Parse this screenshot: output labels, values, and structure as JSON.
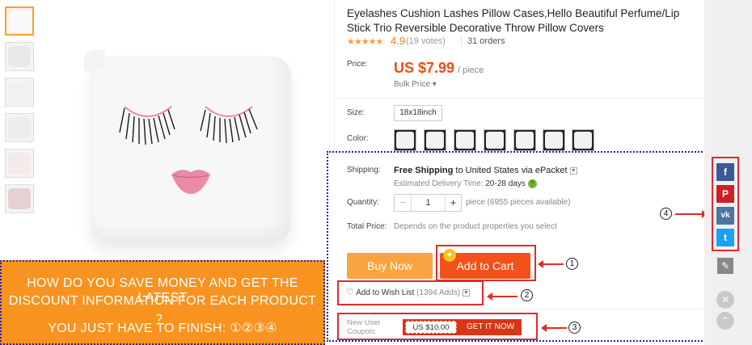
{
  "product": {
    "title": "Eyelashes Cushion Lashes Pillow Cases,Hello Beautiful Perfume/Lip Stick Trio Reversible Decorative Throw Pillow Covers",
    "stars": "★★★★★",
    "rating": "4.9",
    "votes": "(19 votes)",
    "orders": "31 orders"
  },
  "price": {
    "label": "Price:",
    "value": "US $7.99",
    "unit": "/ piece",
    "bulk": "Bulk Price ▾"
  },
  "size": {
    "label": "Size:",
    "option": "18x18inch"
  },
  "color": {
    "label": "Color:"
  },
  "shipping": {
    "label": "Shipping:",
    "free": "Free Shipping",
    "rest": " to United States via ePacket",
    "eta_label": "Estimated Delivery Time:",
    "eta_value": "20-28 days",
    "help_icon": "?"
  },
  "quantity": {
    "label": "Quantity:",
    "minus": "−",
    "value": "1",
    "plus": "+",
    "available": "piece (6955 pieces available)"
  },
  "total": {
    "label": "Total Price:",
    "value": "Depends on the product properties you select"
  },
  "actions": {
    "buy_now": "Buy Now",
    "add_to_cart": "Add to Cart",
    "wishlist": "Add to Wish List",
    "wishlist_count": "(1394 Adds)"
  },
  "coupon": {
    "label": "New User Coupon:",
    "amount": "US $10.00",
    "button": "GET IT NOW"
  },
  "banner": {
    "line1": "HOW DO YOU SAVE MONEY AND GET THE LATEST",
    "line2": "DISCOUNT INFORMATION FOR EACH PRODUCT ？",
    "line3": "YOU JUST HAVE TO FINISH: ①②③④"
  },
  "markers": {
    "m1": "1",
    "m2": "2",
    "m3": "3",
    "m4": "4"
  },
  "social": {
    "facebook": "f",
    "pinterest": "P",
    "vk": "vk",
    "twitter": "t"
  },
  "colors": {
    "accent": "#f04e12",
    "buy": "#f9a440",
    "cart": "#f2521a",
    "banner": "#f7931e",
    "annotation": "#e02b2b"
  }
}
